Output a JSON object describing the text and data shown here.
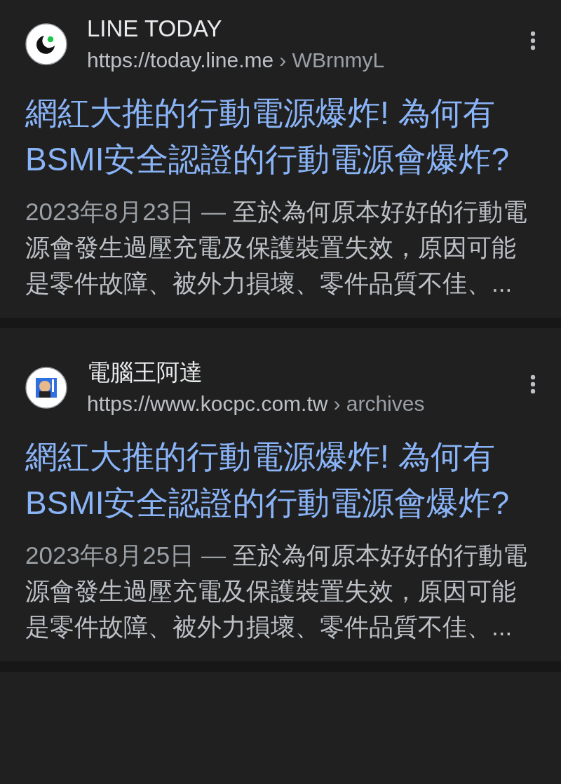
{
  "results": [
    {
      "site_name": "LINE TODAY",
      "url": "https://today.line.me",
      "breadcrumb": "› WBrnmyL",
      "title": "網紅大推的行動電源爆炸! 為何有BSMI安全認證的行動電源會爆炸?",
      "date": "2023年8月23日 — ",
      "snippet": "至於為何原本好好的行動電源會發生過壓充電及保護裝置失效，原因可能是零件故障、被外力損壞、零件品質不佳、..."
    },
    {
      "site_name": "電腦王阿達",
      "url": "https://www.kocpc.com.tw",
      "breadcrumb": "› archives",
      "title": "網紅大推的行動電源爆炸! 為何有BSMI安全認證的行動電源會爆炸?",
      "date": "2023年8月25日 — ",
      "snippet": "至於為何原本好好的行動電源會發生過壓充電及保護裝置失效，原因可能是零件故障、被外力損壞、零件品質不佳、..."
    }
  ]
}
